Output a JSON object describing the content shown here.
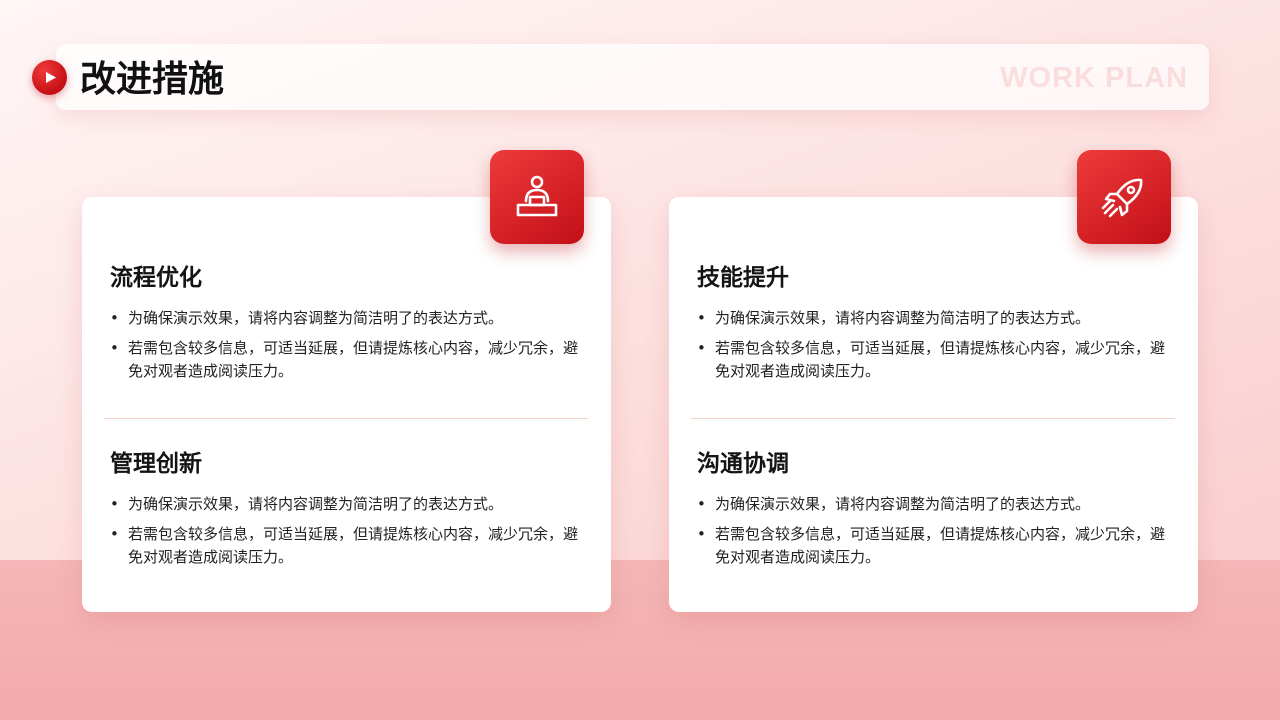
{
  "header": {
    "title": "改进措施",
    "subtitle_en": "WORK PLAN",
    "play_icon": "play-icon"
  },
  "colors": {
    "accent": "#d3141c",
    "background": "#fde1e1",
    "divider": "#f4d2c8"
  },
  "cards": [
    {
      "icon": "workstation-person-icon",
      "sections": [
        {
          "title": "流程优化",
          "bullets": [
            "为确保演示效果，请将内容调整为简洁明了的表达方式。",
            "若需包含较多信息，可适当延展，但请提炼核心内容，减少冗余，避免对观者造成阅读压力。"
          ]
        },
        {
          "title": "管理创新",
          "bullets": [
            "为确保演示效果，请将内容调整为简洁明了的表达方式。",
            "若需包含较多信息，可适当延展，但请提炼核心内容，减少冗余，避免对观者造成阅读压力。"
          ]
        }
      ]
    },
    {
      "icon": "rocket-icon",
      "sections": [
        {
          "title": "技能提升",
          "bullets": [
            "为确保演示效果，请将内容调整为简洁明了的表达方式。",
            "若需包含较多信息，可适当延展，但请提炼核心内容，减少冗余，避免对观者造成阅读压力。"
          ]
        },
        {
          "title": "沟通协调",
          "bullets": [
            "为确保演示效果，请将内容调整为简洁明了的表达方式。",
            "若需包含较多信息，可适当延展，但请提炼核心内容，减少冗余，避免对观者造成阅读压力。"
          ]
        }
      ]
    }
  ]
}
